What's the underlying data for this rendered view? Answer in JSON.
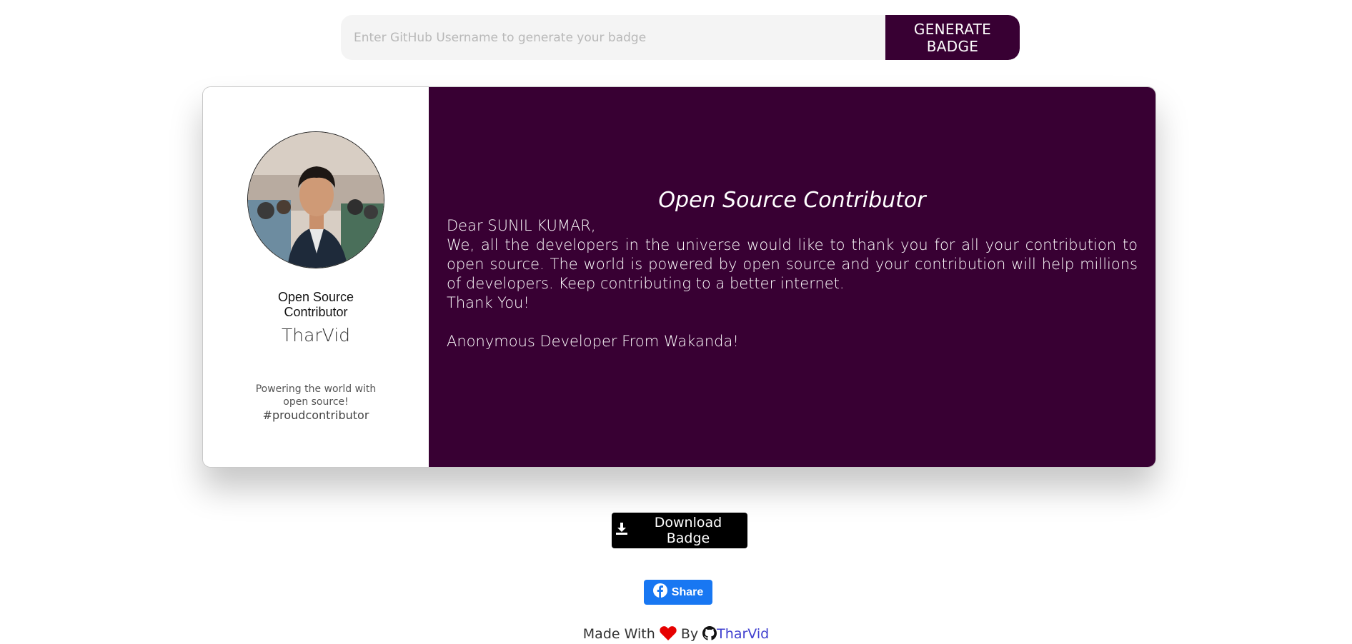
{
  "search": {
    "placeholder": "Enter GitHub Username to generate your badge",
    "value": "",
    "button_label": "GENERATE BADGE"
  },
  "badge": {
    "left": {
      "title": "Open Source Contributor",
      "username": "TharVid",
      "tagline": "Powering the world with open source!",
      "hashtag": "#proudcontributor"
    },
    "right": {
      "title": "Open Source Contributor",
      "greeting": "Dear SUNIL KUMAR,",
      "body": "We, all the developers in the universe would like to thank you for all your contribution to open source. The world is powered by open source and your contribution will help millions of developers. Keep contributing to a better internet.",
      "thanks": "Thank You!",
      "signoff": "Anonymous Developer From Wakanda!"
    },
    "colors": {
      "accent": "#380033",
      "text_on_accent": "#ffffff"
    }
  },
  "actions": {
    "download_label": "Download Badge",
    "share_label": "Share",
    "share_color": "#1877f2"
  },
  "footer": {
    "made_with": "Made With",
    "by": "By",
    "author_link": "TharVid"
  },
  "icons": {
    "download": "download-icon",
    "facebook": "facebook-icon",
    "heart": "heart-icon",
    "github": "github-icon"
  }
}
